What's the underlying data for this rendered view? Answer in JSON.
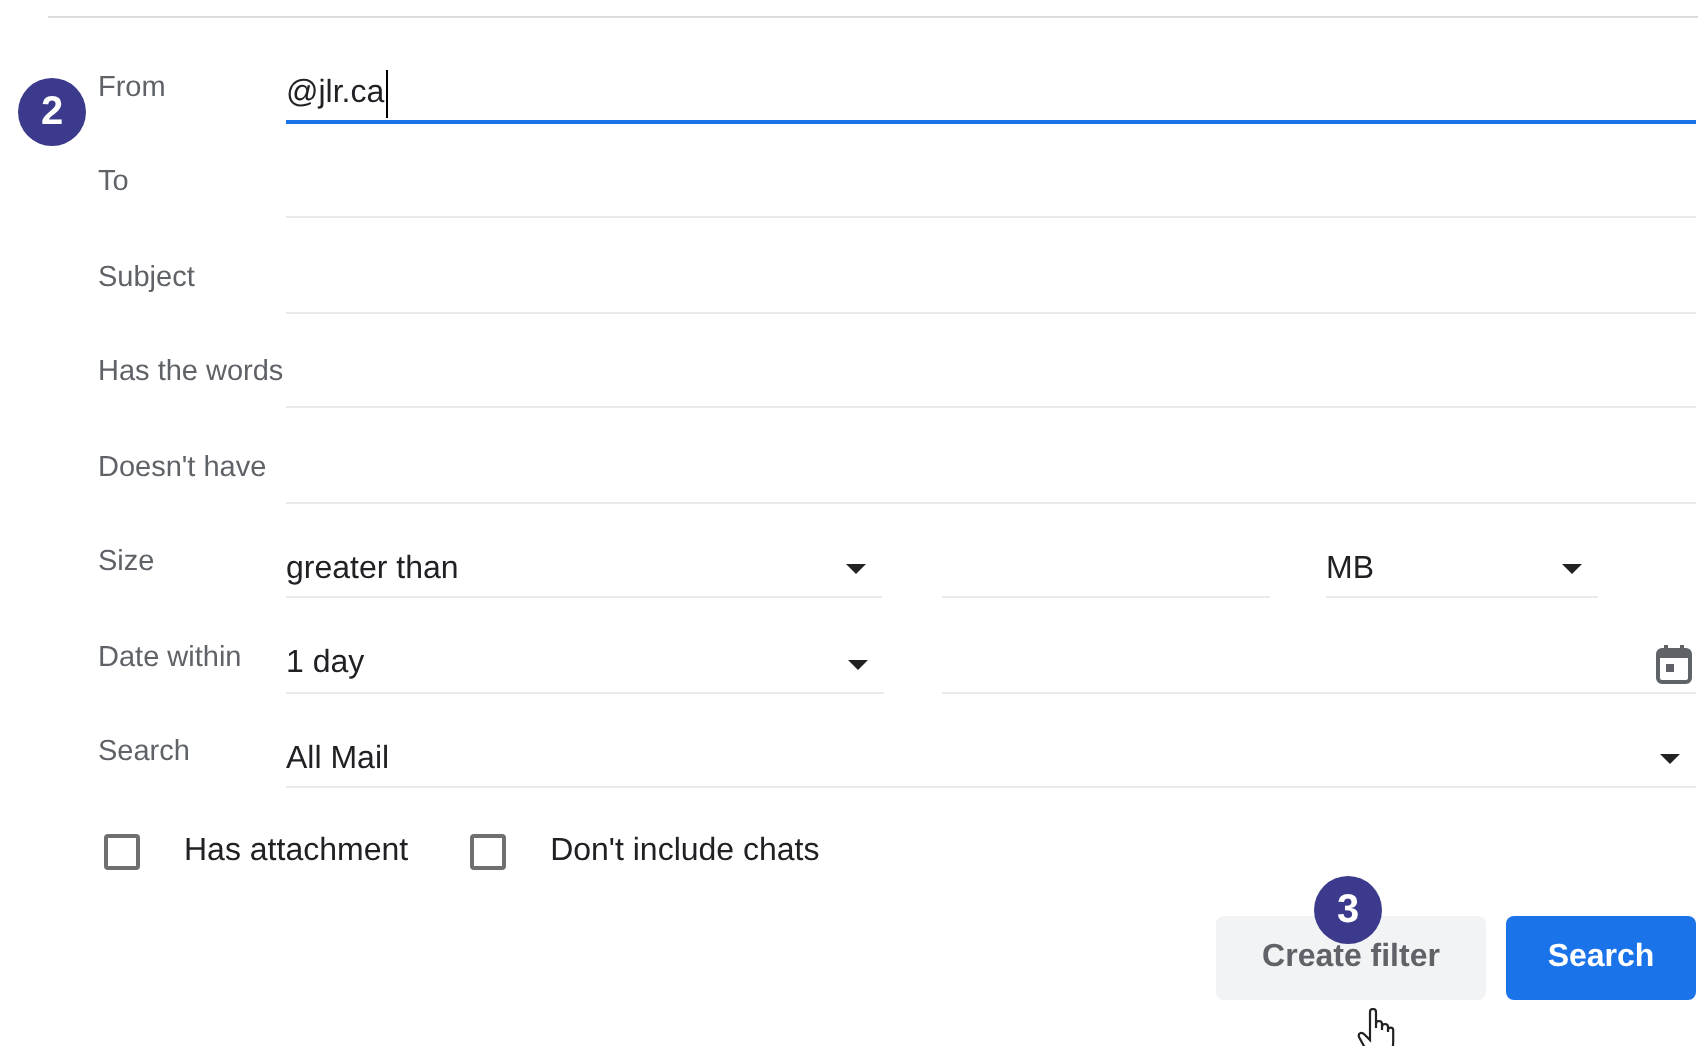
{
  "fields": [
    {
      "kind": "text",
      "label": "From",
      "value": "@jlr.ca",
      "focused": true
    },
    {
      "kind": "text",
      "label": "To",
      "focused": false
    },
    {
      "kind": "text",
      "label": "Subject",
      "focused": false
    },
    {
      "kind": "text",
      "label": "Has the words",
      "focused": false
    },
    {
      "kind": "text",
      "label": "Doesn't have",
      "focused": false
    },
    {
      "kind": "size",
      "label": "Size",
      "value": "greater than",
      "unit": "MB"
    },
    {
      "kind": "date",
      "label": "Date within",
      "value": "1 day"
    },
    {
      "kind": "select",
      "label": "Search",
      "value": "All Mail"
    }
  ],
  "checkboxes": [
    {
      "label": "Has attachment",
      "checked": false
    },
    {
      "label": "Don't include chats",
      "checked": false
    }
  ],
  "buttons": [
    {
      "label": "Create filter",
      "kind": "secondary"
    },
    {
      "label": "Search",
      "kind": "primary"
    }
  ],
  "step_markers": [
    "2",
    "3"
  ]
}
